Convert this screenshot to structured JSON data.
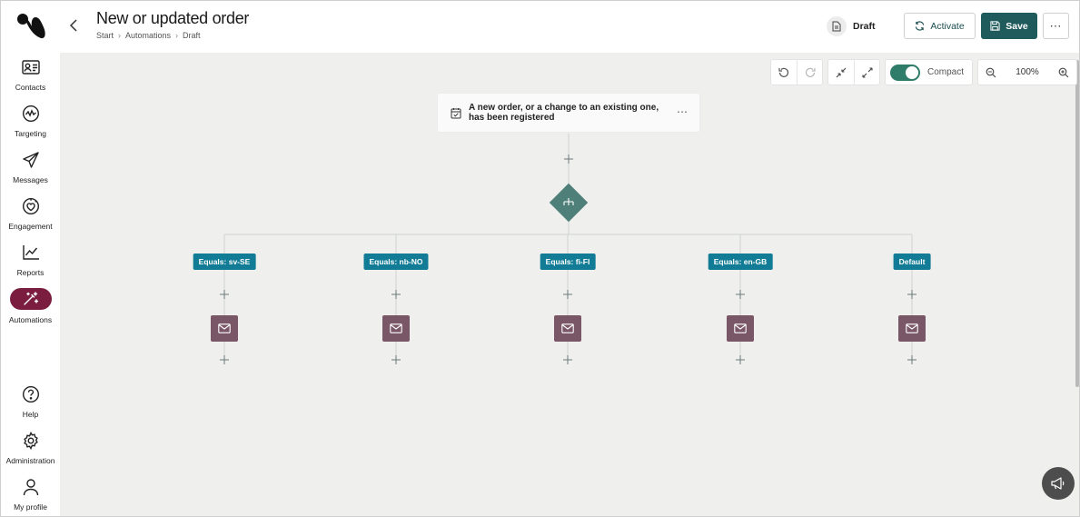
{
  "header": {
    "title": "New or updated order",
    "breadcrumb": [
      "Start",
      "Automations",
      "Draft"
    ],
    "status_label": "Draft",
    "activate_label": "Activate",
    "save_label": "Save",
    "more_label": "⋯"
  },
  "sidebar": {
    "items": [
      {
        "label": "Contacts",
        "icon": "contacts-icon"
      },
      {
        "label": "Targeting",
        "icon": "targeting-icon"
      },
      {
        "label": "Messages",
        "icon": "paper-plane-icon"
      },
      {
        "label": "Engagement",
        "icon": "heart-icon"
      },
      {
        "label": "Reports",
        "icon": "chart-line-icon"
      },
      {
        "label": "Automations",
        "icon": "magic-wand-icon",
        "active": true
      }
    ],
    "bottom_items": [
      {
        "label": "Help",
        "icon": "question-icon"
      },
      {
        "label": "Administration",
        "icon": "gear-icon"
      },
      {
        "label": "My profile",
        "icon": "user-icon"
      }
    ]
  },
  "toolbar": {
    "compact_label": "Compact",
    "compact_on": true,
    "zoom": "100%"
  },
  "flow": {
    "trigger": {
      "text": "A new order, or a change to an existing one, has been registered",
      "more_label": "⋯"
    },
    "branches": [
      {
        "label": "Equals: sv-SE"
      },
      {
        "label": "Equals: nb-NO"
      },
      {
        "label": "Equals: fi-FI"
      },
      {
        "label": "Equals: en-GB"
      },
      {
        "label": "Default"
      }
    ]
  },
  "colors": {
    "accent": "#1f5b5c",
    "active_nav": "#7b1d3e",
    "branch_tag": "#127c96",
    "email_node": "#7a5766",
    "split_node": "#4f7f79",
    "toggle_on": "#2f7c6a"
  }
}
